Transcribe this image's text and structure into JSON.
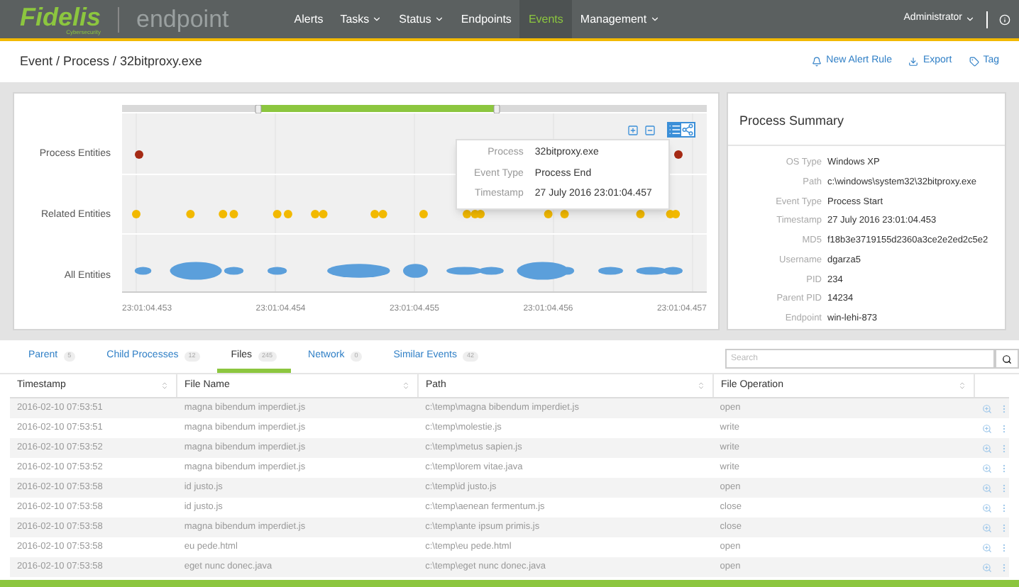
{
  "nav": {
    "logo": "Fidelis",
    "logo_sub": "Cybersecurity",
    "product": "endpoint",
    "items": [
      {
        "label": "Alerts",
        "selected": false,
        "dropdown": false
      },
      {
        "label": "Tasks",
        "selected": false,
        "dropdown": true
      },
      {
        "label": "Status",
        "selected": false,
        "dropdown": true
      },
      {
        "label": "Endpoints",
        "selected": false,
        "dropdown": false
      },
      {
        "label": "Events",
        "selected": true,
        "dropdown": false
      },
      {
        "label": "Management",
        "selected": false,
        "dropdown": true
      }
    ],
    "user": "Administrator"
  },
  "breadcrumb": "Event / Process / 32bitproxy.exe",
  "actions": [
    {
      "kind": "bell",
      "label": "New Alert Rule"
    },
    {
      "kind": "download",
      "label": "Export"
    },
    {
      "kind": "tag",
      "label": "Tag"
    }
  ],
  "timeline": {
    "view_modes": [
      {
        "kind": "list",
        "selected": true
      },
      {
        "kind": "graph",
        "selected": false
      }
    ],
    "rows": [
      "Process Entities",
      "Related Entities",
      "All Entities"
    ],
    "ticks": [
      "23:01:04.453",
      "23:01:04.454",
      "23:01:04.455",
      "23:01:04.456",
      "23:01:04.457"
    ],
    "tooltip": [
      {
        "label": "Process",
        "value": "32bitproxy.exe"
      },
      {
        "label": "Event Type",
        "value": "Process End"
      },
      {
        "label": "Timestamp",
        "value": "27 July 2016 23:01:04.457"
      }
    ]
  },
  "summary": {
    "title": "Process Summary",
    "fields": [
      {
        "label": "OS Type",
        "value": "Windows XP"
      },
      {
        "label": "Path",
        "value": "c:\\windows\\system32\\32bitproxy.exe"
      },
      {
        "label": "Event Type",
        "value": "Process Start"
      },
      {
        "label": "Timestamp",
        "value": "27 July 2016 23:01:04.453"
      },
      {
        "label": "MD5",
        "value": "f18b3e3719155d2360a3ce2e2ed2c5e2"
      },
      {
        "label": "Username",
        "value": "dgarza5"
      },
      {
        "label": "PID",
        "value": "234"
      },
      {
        "label": "Parent PID",
        "value": "14234"
      },
      {
        "label": "Endpoint",
        "value": "win-lehi-873"
      }
    ]
  },
  "tabs": [
    {
      "label": "Parent",
      "count": "5",
      "selected": false
    },
    {
      "label": "Child Processes",
      "count": "12",
      "selected": false
    },
    {
      "label": "Files",
      "count": "245",
      "selected": true
    },
    {
      "label": "Network",
      "count": "0",
      "selected": false
    },
    {
      "label": "Similar Events",
      "count": "42",
      "selected": false
    }
  ],
  "search": {
    "placeholder": "Search"
  },
  "table": {
    "columns": [
      "Timestamp",
      "File Name",
      "Path",
      "File Operation"
    ],
    "rows": [
      [
        "2016-02-10 07:53:51",
        "magna bibendum imperdiet.js",
        "c:\\temp\\magna bibendum imperdiet.js",
        "open"
      ],
      [
        "2016-02-10 07:53:51",
        "magna bibendum imperdiet.js",
        "c:\\temp\\molestie.js",
        "write"
      ],
      [
        "2016-02-10 07:53:52",
        "magna bibendum imperdiet.js",
        "c:\\temp\\metus sapien.js",
        "write"
      ],
      [
        "2016-02-10 07:53:52",
        "magna bibendum imperdiet.js",
        "c:\\temp\\lorem vitae.java",
        "write"
      ],
      [
        "2016-02-10 07:53:58",
        "id justo.js",
        "c:\\temp\\id justo.js",
        "open"
      ],
      [
        "2016-02-10 07:53:58",
        "id justo.js",
        "c:\\temp\\aenean fermentum.js",
        "close"
      ],
      [
        "2016-02-10 07:53:58",
        "magna bibendum imperdiet.js",
        "c:\\temp\\ante ipsum primis.js",
        "close"
      ],
      [
        "2016-02-10 07:53:58",
        "eu pede.html",
        "c:\\temp\\eu pede.html",
        "open"
      ],
      [
        "2016-02-10 07:53:58",
        "eget nunc donec.java",
        "c:\\temp\\eget nunc donec.java",
        "open"
      ]
    ]
  }
}
